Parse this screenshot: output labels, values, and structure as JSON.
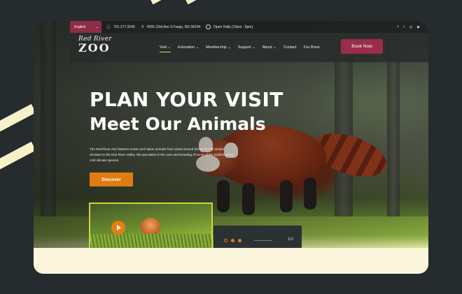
{
  "colors": {
    "background": "#262b2d",
    "accent_pink": "#9b2d4c",
    "accent_orange": "#df7d12",
    "stripe": "#f7f1c9",
    "video_border": "#cbd83a"
  },
  "topbar": {
    "language": "English",
    "phone": "701.277.9240",
    "address": "4255 23rd Ave S Fargo, ND 58104",
    "hours": "Open Daily (10am - 6pm)",
    "social_icons": [
      "facebook-icon",
      "twitter-icon",
      "instagram-icon",
      "youtube-icon"
    ]
  },
  "logo": {
    "line1": "Red River",
    "line2": "ZOO"
  },
  "nav": {
    "items": [
      {
        "label": "Visit",
        "dropdown": true
      },
      {
        "label": "Education",
        "dropdown": true
      },
      {
        "label": "Membership",
        "dropdown": true
      },
      {
        "label": "Support",
        "dropdown": true
      },
      {
        "label": "About",
        "dropdown": true
      },
      {
        "label": "Contact",
        "dropdown": false
      },
      {
        "label": "Zoo Brew",
        "dropdown": false
      }
    ],
    "book_button": "Book Now"
  },
  "hero": {
    "title": "PLAN YOUR VISIT",
    "subtitle": "Meet Our Animals",
    "description": "The Red River Zoo features exotic and native animals from areas around the world with similar climates to the Red River Valley. We specialize in the care and breeding of some of the world's rarest cold climate species.",
    "cta": "Discover"
  },
  "slider": {
    "counter": "1/3",
    "dots": 3,
    "active_dot": 1
  }
}
